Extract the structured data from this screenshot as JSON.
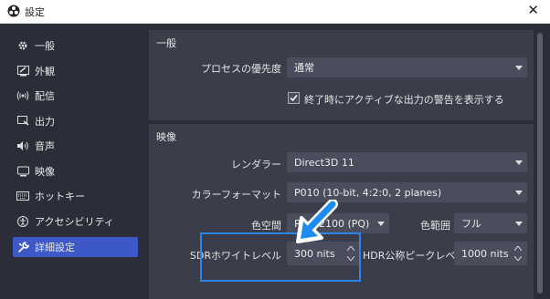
{
  "window": {
    "title": "設定",
    "close_glyph": "✕"
  },
  "sidebar": {
    "items": [
      {
        "label": "一般",
        "icon": "gear-icon"
      },
      {
        "label": "外観",
        "icon": "appearance-icon"
      },
      {
        "label": "配信",
        "icon": "stream-icon"
      },
      {
        "label": "出力",
        "icon": "output-icon"
      },
      {
        "label": "音声",
        "icon": "audio-icon"
      },
      {
        "label": "映像",
        "icon": "video-icon"
      },
      {
        "label": "ホットキー",
        "icon": "keyboard-icon"
      },
      {
        "label": "アクセシビリティ",
        "icon": "accessibility-icon"
      },
      {
        "label": "詳細設定",
        "icon": "wrench-icon"
      }
    ],
    "active": "詳細設定"
  },
  "general": {
    "title": "一般",
    "priority_label": "プロセスの優先度",
    "priority_value": "通常",
    "warn_checkbox_label": "終了時にアクティブな出力の警告を表示する",
    "warn_checked": true
  },
  "video": {
    "title": "映像",
    "renderer_label": "レンダラー",
    "renderer_value": "Direct3D 11",
    "color_format_label": "カラーフォーマット",
    "color_format_value": "P010 (10-bit, 4:2:0, 2 planes)",
    "color_space_label": "色空間",
    "color_space_value": "Rec. 2100 (PQ)",
    "color_range_label": "色範囲",
    "color_range_value": "フル",
    "sdr_white_label": "SDRホワイトレベル",
    "sdr_white_value": "300 nits",
    "hdr_peak_label": "HDR公称ピークレベル",
    "hdr_peak_value": "1000 nits"
  },
  "colors": {
    "accent": "#3c59c7",
    "highlight_box": "#2c86e8",
    "annotation_arrow": "#1e8bf0"
  }
}
